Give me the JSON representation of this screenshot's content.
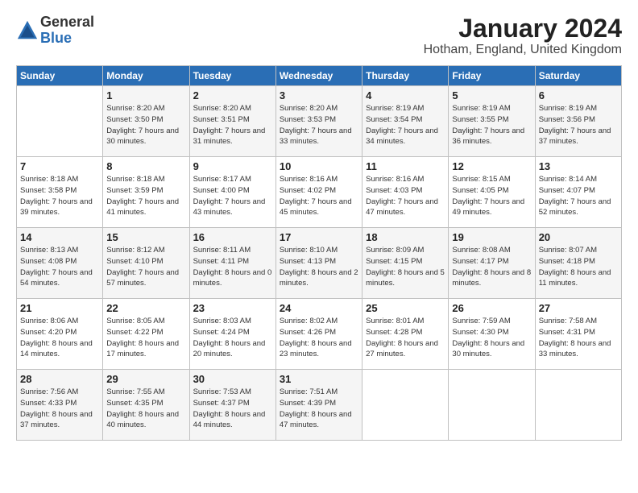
{
  "header": {
    "logo_general": "General",
    "logo_blue": "Blue",
    "title": "January 2024",
    "location": "Hotham, England, United Kingdom"
  },
  "weekdays": [
    "Sunday",
    "Monday",
    "Tuesday",
    "Wednesday",
    "Thursday",
    "Friday",
    "Saturday"
  ],
  "weeks": [
    [
      {
        "day": "",
        "sunrise": "",
        "sunset": "",
        "daylight": ""
      },
      {
        "day": "1",
        "sunrise": "Sunrise: 8:20 AM",
        "sunset": "Sunset: 3:50 PM",
        "daylight": "Daylight: 7 hours and 30 minutes."
      },
      {
        "day": "2",
        "sunrise": "Sunrise: 8:20 AM",
        "sunset": "Sunset: 3:51 PM",
        "daylight": "Daylight: 7 hours and 31 minutes."
      },
      {
        "day": "3",
        "sunrise": "Sunrise: 8:20 AM",
        "sunset": "Sunset: 3:53 PM",
        "daylight": "Daylight: 7 hours and 33 minutes."
      },
      {
        "day": "4",
        "sunrise": "Sunrise: 8:19 AM",
        "sunset": "Sunset: 3:54 PM",
        "daylight": "Daylight: 7 hours and 34 minutes."
      },
      {
        "day": "5",
        "sunrise": "Sunrise: 8:19 AM",
        "sunset": "Sunset: 3:55 PM",
        "daylight": "Daylight: 7 hours and 36 minutes."
      },
      {
        "day": "6",
        "sunrise": "Sunrise: 8:19 AM",
        "sunset": "Sunset: 3:56 PM",
        "daylight": "Daylight: 7 hours and 37 minutes."
      }
    ],
    [
      {
        "day": "7",
        "sunrise": "Sunrise: 8:18 AM",
        "sunset": "Sunset: 3:58 PM",
        "daylight": "Daylight: 7 hours and 39 minutes."
      },
      {
        "day": "8",
        "sunrise": "Sunrise: 8:18 AM",
        "sunset": "Sunset: 3:59 PM",
        "daylight": "Daylight: 7 hours and 41 minutes."
      },
      {
        "day": "9",
        "sunrise": "Sunrise: 8:17 AM",
        "sunset": "Sunset: 4:00 PM",
        "daylight": "Daylight: 7 hours and 43 minutes."
      },
      {
        "day": "10",
        "sunrise": "Sunrise: 8:16 AM",
        "sunset": "Sunset: 4:02 PM",
        "daylight": "Daylight: 7 hours and 45 minutes."
      },
      {
        "day": "11",
        "sunrise": "Sunrise: 8:16 AM",
        "sunset": "Sunset: 4:03 PM",
        "daylight": "Daylight: 7 hours and 47 minutes."
      },
      {
        "day": "12",
        "sunrise": "Sunrise: 8:15 AM",
        "sunset": "Sunset: 4:05 PM",
        "daylight": "Daylight: 7 hours and 49 minutes."
      },
      {
        "day": "13",
        "sunrise": "Sunrise: 8:14 AM",
        "sunset": "Sunset: 4:07 PM",
        "daylight": "Daylight: 7 hours and 52 minutes."
      }
    ],
    [
      {
        "day": "14",
        "sunrise": "Sunrise: 8:13 AM",
        "sunset": "Sunset: 4:08 PM",
        "daylight": "Daylight: 7 hours and 54 minutes."
      },
      {
        "day": "15",
        "sunrise": "Sunrise: 8:12 AM",
        "sunset": "Sunset: 4:10 PM",
        "daylight": "Daylight: 7 hours and 57 minutes."
      },
      {
        "day": "16",
        "sunrise": "Sunrise: 8:11 AM",
        "sunset": "Sunset: 4:11 PM",
        "daylight": "Daylight: 8 hours and 0 minutes."
      },
      {
        "day": "17",
        "sunrise": "Sunrise: 8:10 AM",
        "sunset": "Sunset: 4:13 PM",
        "daylight": "Daylight: 8 hours and 2 minutes."
      },
      {
        "day": "18",
        "sunrise": "Sunrise: 8:09 AM",
        "sunset": "Sunset: 4:15 PM",
        "daylight": "Daylight: 8 hours and 5 minutes."
      },
      {
        "day": "19",
        "sunrise": "Sunrise: 8:08 AM",
        "sunset": "Sunset: 4:17 PM",
        "daylight": "Daylight: 8 hours and 8 minutes."
      },
      {
        "day": "20",
        "sunrise": "Sunrise: 8:07 AM",
        "sunset": "Sunset: 4:18 PM",
        "daylight": "Daylight: 8 hours and 11 minutes."
      }
    ],
    [
      {
        "day": "21",
        "sunrise": "Sunrise: 8:06 AM",
        "sunset": "Sunset: 4:20 PM",
        "daylight": "Daylight: 8 hours and 14 minutes."
      },
      {
        "day": "22",
        "sunrise": "Sunrise: 8:05 AM",
        "sunset": "Sunset: 4:22 PM",
        "daylight": "Daylight: 8 hours and 17 minutes."
      },
      {
        "day": "23",
        "sunrise": "Sunrise: 8:03 AM",
        "sunset": "Sunset: 4:24 PM",
        "daylight": "Daylight: 8 hours and 20 minutes."
      },
      {
        "day": "24",
        "sunrise": "Sunrise: 8:02 AM",
        "sunset": "Sunset: 4:26 PM",
        "daylight": "Daylight: 8 hours and 23 minutes."
      },
      {
        "day": "25",
        "sunrise": "Sunrise: 8:01 AM",
        "sunset": "Sunset: 4:28 PM",
        "daylight": "Daylight: 8 hours and 27 minutes."
      },
      {
        "day": "26",
        "sunrise": "Sunrise: 7:59 AM",
        "sunset": "Sunset: 4:30 PM",
        "daylight": "Daylight: 8 hours and 30 minutes."
      },
      {
        "day": "27",
        "sunrise": "Sunrise: 7:58 AM",
        "sunset": "Sunset: 4:31 PM",
        "daylight": "Daylight: 8 hours and 33 minutes."
      }
    ],
    [
      {
        "day": "28",
        "sunrise": "Sunrise: 7:56 AM",
        "sunset": "Sunset: 4:33 PM",
        "daylight": "Daylight: 8 hours and 37 minutes."
      },
      {
        "day": "29",
        "sunrise": "Sunrise: 7:55 AM",
        "sunset": "Sunset: 4:35 PM",
        "daylight": "Daylight: 8 hours and 40 minutes."
      },
      {
        "day": "30",
        "sunrise": "Sunrise: 7:53 AM",
        "sunset": "Sunset: 4:37 PM",
        "daylight": "Daylight: 8 hours and 44 minutes."
      },
      {
        "day": "31",
        "sunrise": "Sunrise: 7:51 AM",
        "sunset": "Sunset: 4:39 PM",
        "daylight": "Daylight: 8 hours and 47 minutes."
      },
      {
        "day": "",
        "sunrise": "",
        "sunset": "",
        "daylight": ""
      },
      {
        "day": "",
        "sunrise": "",
        "sunset": "",
        "daylight": ""
      },
      {
        "day": "",
        "sunrise": "",
        "sunset": "",
        "daylight": ""
      }
    ]
  ]
}
